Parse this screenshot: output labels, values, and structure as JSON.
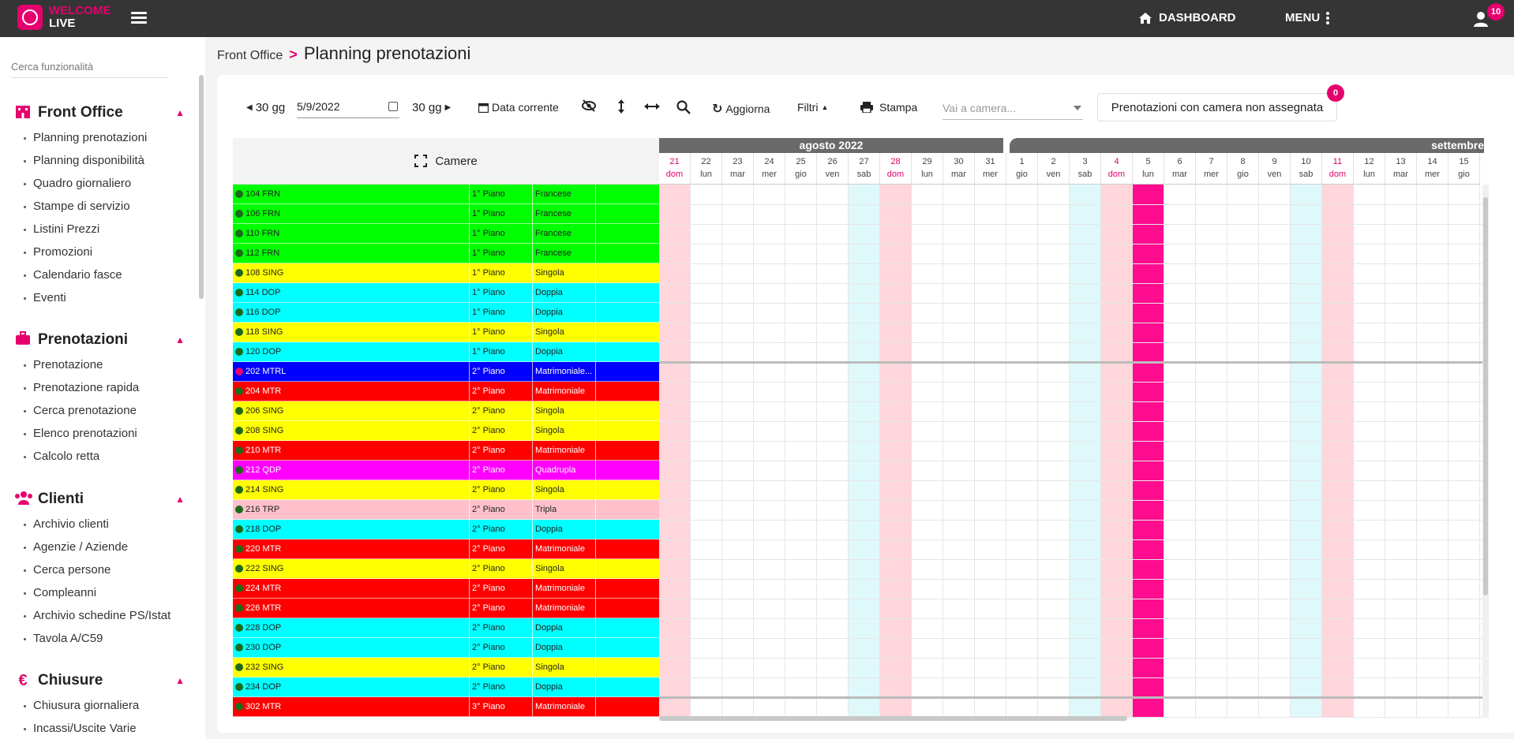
{
  "app": {
    "logo_top": "WELCOME",
    "logo_bottom": "LIVE"
  },
  "topbar": {
    "dashboard_label": "DASHBOARD",
    "menu_label": "MENU",
    "notifications_count": "10"
  },
  "sidebar": {
    "search_placeholder": "Cerca funzionalità",
    "sections": [
      {
        "title": "Front Office",
        "icon": "hotel-icon",
        "items": [
          "Planning prenotazioni",
          "Planning disponibilità",
          "Quadro giornaliero",
          "Stampe di servizio",
          "Listini Prezzi",
          "Promozioni",
          "Calendario fasce",
          "Eventi"
        ]
      },
      {
        "title": "Prenotazioni",
        "icon": "briefcase-icon",
        "items": [
          "Prenotazione",
          "Prenotazione rapida",
          "Cerca prenotazione",
          "Elenco prenotazioni",
          "Calcolo retta"
        ]
      },
      {
        "title": "Clienti",
        "icon": "users-icon",
        "items": [
          "Archivio clienti",
          "Agenzie / Aziende",
          "Cerca persone",
          "Compleanni",
          "Archivio schedine PS/Istat",
          "Tavola A/C59"
        ]
      },
      {
        "title": "Chiusure",
        "icon": "euro-icon",
        "items": [
          "Chiusura giornaliera",
          "Incassi/Uscite Varie"
        ]
      }
    ]
  },
  "breadcrumb": {
    "root": "Front Office",
    "separator": ">",
    "title": "Planning prenotazioni"
  },
  "toolbar": {
    "prev_label": "30 gg",
    "date_value": "5/9/2022",
    "next_label": "30 gg",
    "today_label": "Data corrente",
    "refresh_label": "Aggiorna",
    "filters_label": "Filtri",
    "print_label": "Stampa",
    "camera_placeholder": "Vai a camera...",
    "unassigned_label": "Prenotazioni con camera non assegnata",
    "unassigned_count": "0"
  },
  "planner": {
    "rooms_header": "Camere",
    "months": [
      {
        "label": "agosto 2022"
      },
      {
        "label": "settembre"
      }
    ],
    "days": [
      {
        "n": "21",
        "d": "dom"
      },
      {
        "n": "22",
        "d": "lun"
      },
      {
        "n": "23",
        "d": "mar"
      },
      {
        "n": "24",
        "d": "mer"
      },
      {
        "n": "25",
        "d": "gio"
      },
      {
        "n": "26",
        "d": "ven"
      },
      {
        "n": "27",
        "d": "sab"
      },
      {
        "n": "28",
        "d": "dom"
      },
      {
        "n": "29",
        "d": "lun"
      },
      {
        "n": "30",
        "d": "mar"
      },
      {
        "n": "31",
        "d": "mer"
      },
      {
        "n": "1",
        "d": "gio"
      },
      {
        "n": "2",
        "d": "ven"
      },
      {
        "n": "3",
        "d": "sab"
      },
      {
        "n": "4",
        "d": "dom"
      },
      {
        "n": "5",
        "d": "lun"
      },
      {
        "n": "6",
        "d": "mar"
      },
      {
        "n": "7",
        "d": "mer"
      },
      {
        "n": "8",
        "d": "gio"
      },
      {
        "n": "9",
        "d": "ven"
      },
      {
        "n": "10",
        "d": "sab"
      },
      {
        "n": "11",
        "d": "dom"
      },
      {
        "n": "12",
        "d": "lun"
      },
      {
        "n": "13",
        "d": "mar"
      },
      {
        "n": "14",
        "d": "mer"
      },
      {
        "n": "15",
        "d": "gio"
      }
    ],
    "rooms": [
      {
        "name": "104 FRN",
        "floor": "1° Piano",
        "type": "Francese",
        "color": "#00ff00"
      },
      {
        "name": "106 FRN",
        "floor": "1° Piano",
        "type": "Francese",
        "color": "#00ff00"
      },
      {
        "name": "110 FRN",
        "floor": "1° Piano",
        "type": "Francese",
        "color": "#00ff00"
      },
      {
        "name": "112 FRN",
        "floor": "1° Piano",
        "type": "Francese",
        "color": "#00ff00"
      },
      {
        "name": "108 SING",
        "floor": "1° Piano",
        "type": "Singola",
        "color": "#ffff00"
      },
      {
        "name": "114 DOP",
        "floor": "1° Piano",
        "type": "Doppia",
        "color": "#00ffff"
      },
      {
        "name": "116 DOP",
        "floor": "1° Piano",
        "type": "Doppia",
        "color": "#00ffff"
      },
      {
        "name": "118 SING",
        "floor": "1° Piano",
        "type": "Singola",
        "color": "#ffff00"
      },
      {
        "name": "120 DOP",
        "floor": "1° Piano",
        "type": "Doppia",
        "color": "#00ffff"
      },
      {
        "name": "202 MTRL",
        "floor": "2° Piano",
        "type": "Matrimoniale...",
        "color": "#0000ff",
        "light": true,
        "dot": "#e5006d"
      },
      {
        "name": "204 MTR",
        "floor": "2° Piano",
        "type": "Matrimoniale",
        "color": "#ff0000",
        "light": true
      },
      {
        "name": "206 SING",
        "floor": "2° Piano",
        "type": "Singola",
        "color": "#ffff00"
      },
      {
        "name": "208 SING",
        "floor": "2° Piano",
        "type": "Singola",
        "color": "#ffff00"
      },
      {
        "name": "210 MTR",
        "floor": "2° Piano",
        "type": "Matrimoniale",
        "color": "#ff0000",
        "light": true
      },
      {
        "name": "212 QDP",
        "floor": "2° Piano",
        "type": "Quadrupla",
        "color": "#ff00ff",
        "light": true
      },
      {
        "name": "214 SING",
        "floor": "2° Piano",
        "type": "Singola",
        "color": "#ffff00"
      },
      {
        "name": "216 TRP",
        "floor": "2° Piano",
        "type": "Tripla",
        "color": "#ffc0cb"
      },
      {
        "name": "218 DOP",
        "floor": "2° Piano",
        "type": "Doppia",
        "color": "#00ffff"
      },
      {
        "name": "220 MTR",
        "floor": "2° Piano",
        "type": "Matrimoniale",
        "color": "#ff0000",
        "light": true
      },
      {
        "name": "222 SING",
        "floor": "2° Piano",
        "type": "Singola",
        "color": "#ffff00"
      },
      {
        "name": "224 MTR",
        "floor": "2° Piano",
        "type": "Matrimoniale",
        "color": "#ff0000",
        "light": true
      },
      {
        "name": "226 MTR",
        "floor": "2° Piano",
        "type": "Matrimoniale",
        "color": "#ff0000",
        "light": true
      },
      {
        "name": "228 DOP",
        "floor": "2° Piano",
        "type": "Doppia",
        "color": "#00ffff"
      },
      {
        "name": "230 DOP",
        "floor": "2° Piano",
        "type": "Doppia",
        "color": "#00ffff"
      },
      {
        "name": "232 SING",
        "floor": "2° Piano",
        "type": "Singola",
        "color": "#ffff00"
      },
      {
        "name": "234 DOP",
        "floor": "2° Piano",
        "type": "Doppia",
        "color": "#00ffff"
      },
      {
        "name": "302 MTR",
        "floor": "3° Piano",
        "type": "Matrimoniale",
        "color": "#ff0000",
        "light": true
      }
    ],
    "colors": {
      "sunday": "#ffd6dc",
      "saturday": "#dff9fb",
      "today": "#ff0c8f",
      "accent": "#e5006d"
    },
    "today_index": 15
  }
}
